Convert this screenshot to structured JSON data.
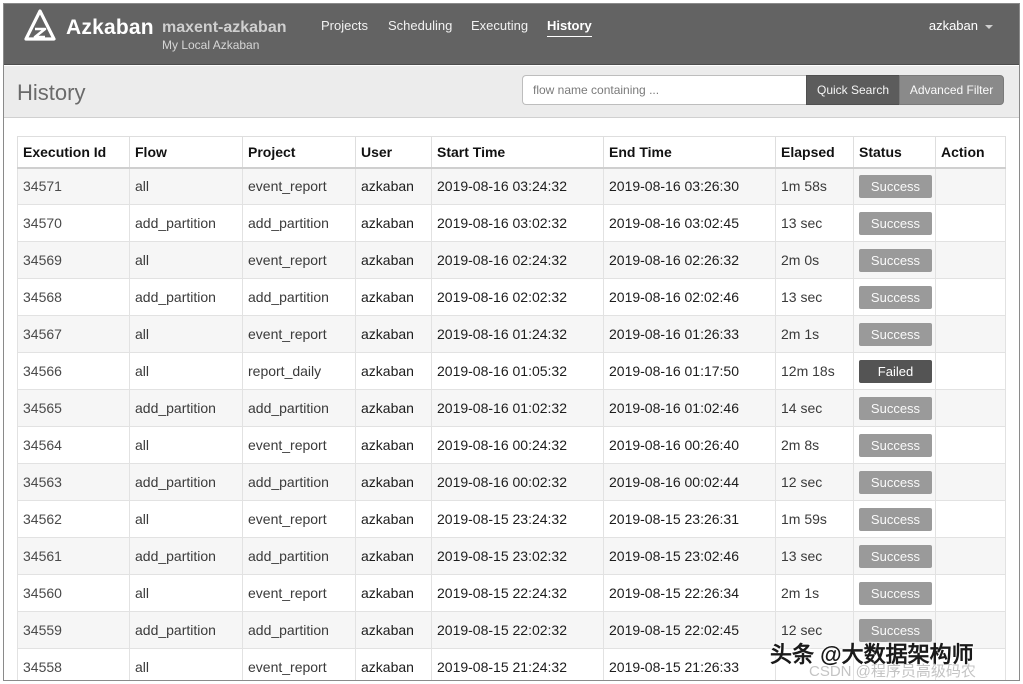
{
  "nav": {
    "brand": "Azkaban",
    "instance": "maxent-azkaban",
    "instance_label": "My Local Azkaban",
    "links": [
      "Projects",
      "Scheduling",
      "Executing",
      "History"
    ],
    "active": "History",
    "user": "azkaban"
  },
  "header": {
    "title": "History",
    "search_placeholder": "flow name containing ...",
    "quick_search": "Quick Search",
    "advanced_filter": "Advanced Filter"
  },
  "table": {
    "columns": [
      "Execution Id",
      "Flow",
      "Project",
      "User",
      "Start Time",
      "End Time",
      "Elapsed",
      "Status",
      "Action"
    ],
    "rows": [
      {
        "id": "34571",
        "flow": "all",
        "project": "event_report",
        "user": "azkaban",
        "start": "2019-08-16 03:24:32",
        "end": "2019-08-16 03:26:30",
        "elapsed": "1m 58s",
        "status": "Success",
        "action": ""
      },
      {
        "id": "34570",
        "flow": "add_partition",
        "project": "add_partition",
        "user": "azkaban",
        "start": "2019-08-16 03:02:32",
        "end": "2019-08-16 03:02:45",
        "elapsed": "13 sec",
        "status": "Success",
        "action": ""
      },
      {
        "id": "34569",
        "flow": "all",
        "project": "event_report",
        "user": "azkaban",
        "start": "2019-08-16 02:24:32",
        "end": "2019-08-16 02:26:32",
        "elapsed": "2m 0s",
        "status": "Success",
        "action": ""
      },
      {
        "id": "34568",
        "flow": "add_partition",
        "project": "add_partition",
        "user": "azkaban",
        "start": "2019-08-16 02:02:32",
        "end": "2019-08-16 02:02:46",
        "elapsed": "13 sec",
        "status": "Success",
        "action": ""
      },
      {
        "id": "34567",
        "flow": "all",
        "project": "event_report",
        "user": "azkaban",
        "start": "2019-08-16 01:24:32",
        "end": "2019-08-16 01:26:33",
        "elapsed": "2m 1s",
        "status": "Success",
        "action": ""
      },
      {
        "id": "34566",
        "flow": "all",
        "project": "report_daily",
        "user": "azkaban",
        "start": "2019-08-16 01:05:32",
        "end": "2019-08-16 01:17:50",
        "elapsed": "12m 18s",
        "status": "Failed",
        "action": ""
      },
      {
        "id": "34565",
        "flow": "add_partition",
        "project": "add_partition",
        "user": "azkaban",
        "start": "2019-08-16 01:02:32",
        "end": "2019-08-16 01:02:46",
        "elapsed": "14 sec",
        "status": "Success",
        "action": ""
      },
      {
        "id": "34564",
        "flow": "all",
        "project": "event_report",
        "user": "azkaban",
        "start": "2019-08-16 00:24:32",
        "end": "2019-08-16 00:26:40",
        "elapsed": "2m 8s",
        "status": "Success",
        "action": ""
      },
      {
        "id": "34563",
        "flow": "add_partition",
        "project": "add_partition",
        "user": "azkaban",
        "start": "2019-08-16 00:02:32",
        "end": "2019-08-16 00:02:44",
        "elapsed": "12 sec",
        "status": "Success",
        "action": ""
      },
      {
        "id": "34562",
        "flow": "all",
        "project": "event_report",
        "user": "azkaban",
        "start": "2019-08-15 23:24:32",
        "end": "2019-08-15 23:26:31",
        "elapsed": "1m 59s",
        "status": "Success",
        "action": ""
      },
      {
        "id": "34561",
        "flow": "add_partition",
        "project": "add_partition",
        "user": "azkaban",
        "start": "2019-08-15 23:02:32",
        "end": "2019-08-15 23:02:46",
        "elapsed": "13 sec",
        "status": "Success",
        "action": ""
      },
      {
        "id": "34560",
        "flow": "all",
        "project": "event_report",
        "user": "azkaban",
        "start": "2019-08-15 22:24:32",
        "end": "2019-08-15 22:26:34",
        "elapsed": "2m 1s",
        "status": "Success",
        "action": ""
      },
      {
        "id": "34559",
        "flow": "add_partition",
        "project": "add_partition",
        "user": "azkaban",
        "start": "2019-08-15 22:02:32",
        "end": "2019-08-15 22:02:45",
        "elapsed": "12 sec",
        "status": "Success",
        "action": ""
      },
      {
        "id": "34558",
        "flow": "all",
        "project": "event_report",
        "user": "azkaban",
        "start": "2019-08-15 21:24:32",
        "end": "2019-08-15 21:26:33",
        "elapsed": "",
        "status": "",
        "action": ""
      }
    ]
  },
  "watermark": {
    "main": "头条 @大数据架构师",
    "sub": "CSDN @程序员高级码农"
  },
  "colors": {
    "navbar": "#636363",
    "header_bg": "#ececec",
    "success_badge": "#9a9a9a",
    "failed_badge": "#545454",
    "quick_search_button": "#5c5c5c",
    "advanced_filter_button": "#8a8a8a"
  }
}
